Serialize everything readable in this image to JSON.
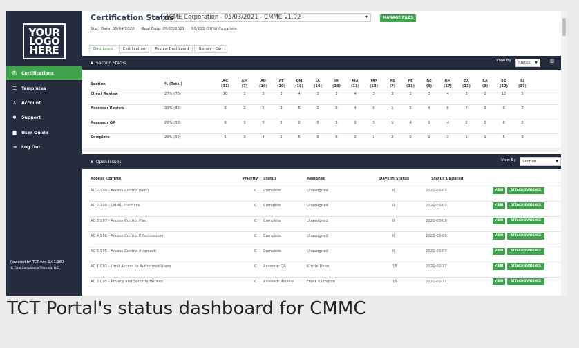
{
  "logo": {
    "lines": [
      "YOUR",
      "LOGO",
      "HERE"
    ]
  },
  "sidebar": {
    "items": [
      {
        "label": "Certifications",
        "icon": "certifications-icon",
        "glyph": "⎘",
        "active": true
      },
      {
        "label": "Templates",
        "icon": "list-icon",
        "glyph": "☰",
        "active": false
      },
      {
        "label": "Account",
        "icon": "user-icon",
        "glyph": "♙",
        "active": false
      },
      {
        "label": "Support",
        "icon": "support-icon",
        "glyph": "✱",
        "active": false
      },
      {
        "label": "User Guide",
        "icon": "book-icon",
        "glyph": "▇",
        "active": false
      },
      {
        "label": "Log Out",
        "icon": "logout-icon",
        "glyph": "⇥",
        "active": false
      }
    ],
    "powered_by": "Powered by TCT ver. 1.01.160",
    "copyright": "© Total Compliance Tracking, LLC"
  },
  "header": {
    "title": "Certification Status",
    "org_select": "ACME Corporation - 05/03/2021 - CMMC v1.02",
    "manage_files": "MANAGE FILES",
    "start_date": "Start Date: 05/04/2020",
    "goal_date": "Goal Date: 05/03/2021",
    "progress": "50/255 (20%) Complete"
  },
  "tabs": [
    {
      "label": "Dashboard",
      "active": true
    },
    {
      "label": "Certification",
      "active": false
    },
    {
      "label": "Review Dashboard",
      "active": false
    },
    {
      "label": "History - Cert",
      "active": false
    }
  ],
  "section_status": {
    "title": "Section Status",
    "view_by_label": "View By",
    "view_by_value": "Status",
    "columns": [
      "Section",
      "% (Total)",
      "AC (31)",
      "AM (7)",
      "AU (19)",
      "AT (10)",
      "CM (16)",
      "IA (16)",
      "IR (18)",
      "MA (11)",
      "MP (13)",
      "PS (7)",
      "PE (11)",
      "RE (9)",
      "RM (17)",
      "CA (13)",
      "SA (8)",
      "SC (32)",
      "SI (17)"
    ],
    "rows": [
      {
        "section": "Client Review",
        "pct": "27% (70)",
        "values": [
          "10",
          "1",
          "5",
          "3",
          "4",
          "3",
          "3",
          "4",
          "3",
          "3",
          "2",
          "3",
          "4",
          "3",
          "2",
          "12",
          "5"
        ]
      },
      {
        "section": "Assessor Review",
        "pct": "33% (83)",
        "values": [
          "8",
          "2",
          "5",
          "3",
          "5",
          "2",
          "6",
          "4",
          "6",
          "1",
          "5",
          "4",
          "6",
          "7",
          "3",
          "9",
          "7"
        ]
      },
      {
        "section": "Assessor QA",
        "pct": "20% (52)",
        "values": [
          "8",
          "1",
          "5",
          "2",
          "2",
          "5",
          "3",
          "1",
          "3",
          "1",
          "4",
          "1",
          "4",
          "2",
          "2",
          "6",
          "2"
        ]
      },
      {
        "section": "Complete",
        "pct": "20% (50)",
        "values": [
          "5",
          "3",
          "4",
          "2",
          "5",
          "6",
          "6",
          "2",
          "1",
          "2",
          "0",
          "1",
          "3",
          "1",
          "1",
          "5",
          "3"
        ]
      }
    ]
  },
  "open_issues": {
    "title": "Open Issues",
    "view_by_label": "View By",
    "view_by_value": "Section",
    "columns": [
      "Access Control",
      "Priority",
      "Status",
      "Assigned",
      "Days in Status",
      "Status Updated"
    ],
    "view_label": "VIEW",
    "attach_label": "ATTACH EVIDENCE",
    "rows": [
      {
        "name": "AC.2.999 - Access Control Policy",
        "priority": "C",
        "status": "Complete",
        "assigned": "Unassigned",
        "days": "0",
        "updated": "2021-03-09"
      },
      {
        "name": "AC.2.998 - CMMC Practices",
        "priority": "C",
        "status": "Complete",
        "assigned": "Unassigned",
        "days": "0",
        "updated": "2021-03-09"
      },
      {
        "name": "AC.3.997 - Access Control Plan",
        "priority": "C",
        "status": "Complete",
        "assigned": "Unassigned",
        "days": "0",
        "updated": "2021-03-09"
      },
      {
        "name": "AC.4.996 - Access Control Effectiveness",
        "priority": "C",
        "status": "Complete",
        "assigned": "Unassigned",
        "days": "0",
        "updated": "2021-03-09"
      },
      {
        "name": "AC.5.995 - Access Control Approach",
        "priority": "C",
        "status": "Complete",
        "assigned": "Unassigned",
        "days": "0",
        "updated": "2021-03-09"
      },
      {
        "name": "AC.1.001 - Limit Access to Authorized Users",
        "priority": "C",
        "status": "Assessor QA",
        "assigned": "Kristin Deen",
        "days": "15",
        "updated": "2021-02-22"
      },
      {
        "name": "AC.2.005 - Privacy and Security Notices",
        "priority": "C",
        "status": "Assessor Review",
        "assigned": "Frank Killington",
        "days": "15",
        "updated": "2021-02-22"
      }
    ]
  },
  "caption": "TCT Portal's status dashboard for CMMC",
  "colors": {
    "sidebar": "#252c3d",
    "accent": "#3fa34d"
  }
}
